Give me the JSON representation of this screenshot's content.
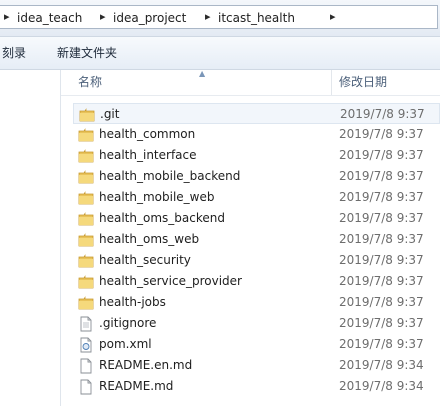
{
  "breadcrumb": {
    "items": [
      "idea_teach",
      "idea_project",
      "itcast_health"
    ]
  },
  "toolbar": {
    "burn_label": "刻录",
    "new_folder_label": "新建文件夹"
  },
  "columns": {
    "name": "名称",
    "modified": "修改日期"
  },
  "files": [
    {
      "name": ".git",
      "date": "2019/7/8 9:37",
      "type": "folder",
      "selected": true
    },
    {
      "name": "health_common",
      "date": "2019/7/8 9:37",
      "type": "folder"
    },
    {
      "name": "health_interface",
      "date": "2019/7/8 9:37",
      "type": "folder"
    },
    {
      "name": "health_mobile_backend",
      "date": "2019/7/8 9:37",
      "type": "folder"
    },
    {
      "name": "health_mobile_web",
      "date": "2019/7/8 9:37",
      "type": "folder"
    },
    {
      "name": "health_oms_backend",
      "date": "2019/7/8 9:37",
      "type": "folder"
    },
    {
      "name": "health_oms_web",
      "date": "2019/7/8 9:37",
      "type": "folder"
    },
    {
      "name": "health_security",
      "date": "2019/7/8 9:37",
      "type": "folder"
    },
    {
      "name": "health_service_provider",
      "date": "2019/7/8 9:37",
      "type": "folder"
    },
    {
      "name": "health-jobs",
      "date": "2019/7/8 9:37",
      "type": "folder"
    },
    {
      "name": ".gitignore",
      "date": "2019/7/8 9:37",
      "type": "text-file"
    },
    {
      "name": "pom.xml",
      "date": "2019/7/8 9:37",
      "type": "xml-file"
    },
    {
      "name": "README.en.md",
      "date": "2019/7/8 9:34",
      "type": "md-file"
    },
    {
      "name": "README.md",
      "date": "2019/7/8 9:34",
      "type": "md-file"
    }
  ]
}
